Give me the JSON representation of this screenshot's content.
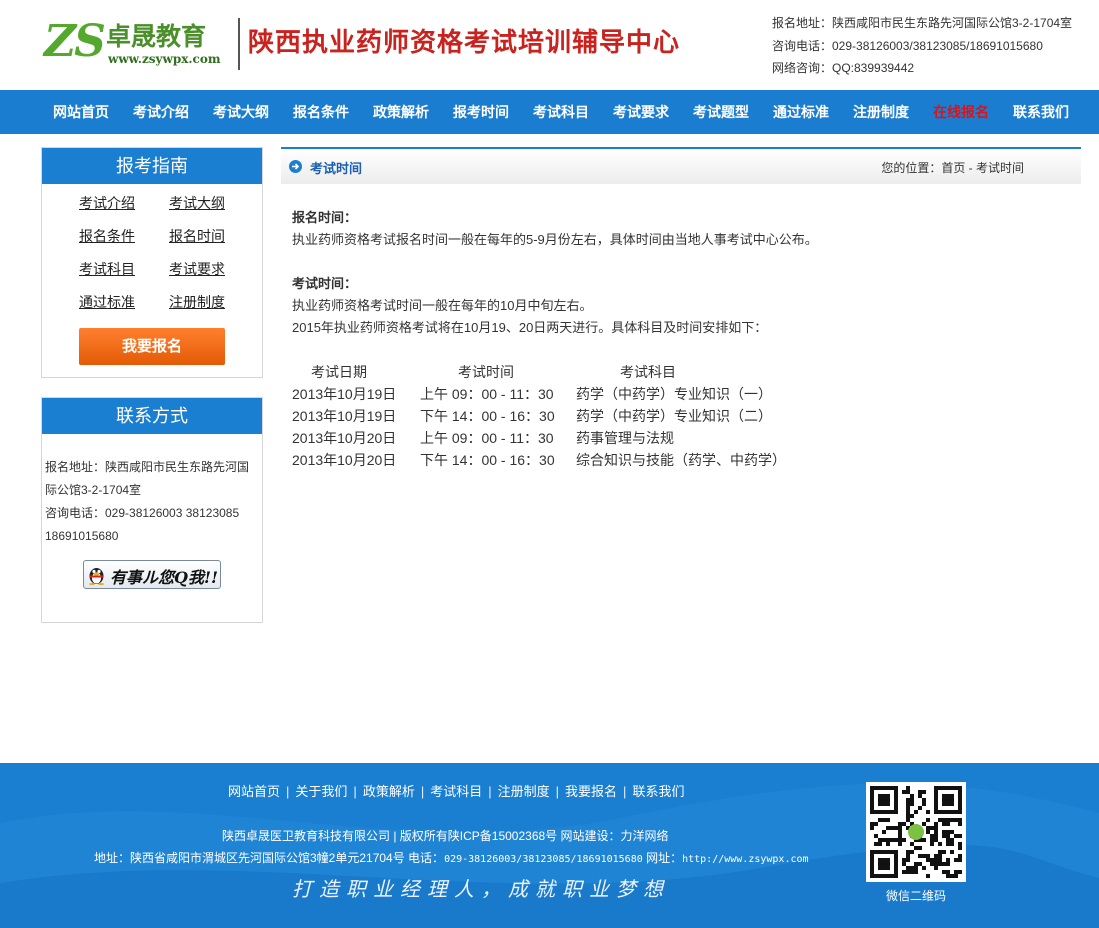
{
  "header": {
    "logo_mark": "ZS",
    "logo_name": "卓晟教育",
    "logo_url": "www.zsywpx.com",
    "site_title": "陕西执业药师资格考试培训辅导中心",
    "info": [
      "报名地址：陕西咸阳市民生东路先河国际公馆3-2-1704室",
      "咨询电话：029-38126003/38123085/18691015680",
      "网络咨询：QQ:839939442"
    ]
  },
  "nav": {
    "items": [
      "网站首页",
      "考试介绍",
      "考试大纲",
      "报名条件",
      "政策解析",
      "报考时间",
      "考试科目",
      "考试要求",
      "考试题型",
      "通过标准",
      "注册制度",
      "在线报名",
      "联系我们"
    ],
    "active_index": 11,
    "active_color": "#d8151b"
  },
  "sidebar": {
    "guide_title": "报考指南",
    "guide_links": [
      "考试介绍",
      "考试大纲",
      "报名条件",
      "报名时间",
      "考试科目",
      "考试要求",
      "通过标准",
      "注册制度"
    ],
    "signup_button": "我要报名",
    "contact_title": "联系方式",
    "contact_address": "报名地址：陕西咸阳市民生东路先河国际公馆3-2-1704室",
    "contact_phone": "咨询电话：029-38126003 38123085 18691015680",
    "qq_button": "有事ル您Q我!!"
  },
  "main": {
    "section_title": "考试时间",
    "breadcrumb": "您的位置：首页 - 考试时间",
    "signup_label": "报名时间：",
    "signup_text": "执业药师资格考试报名时间一般在每年的5-9月份左右，具体时间由当地人事考试中心公布。",
    "exam_label": "考试时间：",
    "exam_text_1": "执业药师资格考试时间一般在每年的10月中旬左右。",
    "exam_text_2": "2015年执业药师资格考试将在10月19、20日两天进行。具体科目及时间安排如下：",
    "schedule_headers": [
      "考试日期",
      "考试时间",
      "考试科目"
    ],
    "schedule_rows": [
      [
        "2013年10月19日",
        "上午 09：00 - 11：30",
        "药学（中药学）专业知识（一）"
      ],
      [
        "2013年10月19日",
        "下午 14：00 - 16：30",
        "药学（中药学）专业知识（二）"
      ],
      [
        "2013年10月20日",
        "上午 09：00 - 11：30",
        "药事管理与法规"
      ],
      [
        "2013年10月20日",
        "下午 14：00 - 16：30",
        "综合知识与技能（药学、中药学）"
      ]
    ]
  },
  "footer": {
    "links": [
      "网站首页",
      "关于我们",
      "政策解析",
      "考试科目",
      "注册制度",
      "我要报名",
      "联系我们"
    ],
    "company": "陕西卓晟医卫教育科技有限公司 | 版权所有陕ICP备15002368号 网站建设：力洋网络",
    "address_prefix": "地址：陕西省咸阳市渭城区先河国际公馆3幢2单元21704号 电话：",
    "address_phones": "029-38126003/38123085/18691015680",
    "address_site_label": " 网址：",
    "address_url": "http://www.zsywpx.com",
    "slogan": "打造职业经理人，成就职业梦想",
    "qr_caption": "微信二维码"
  }
}
